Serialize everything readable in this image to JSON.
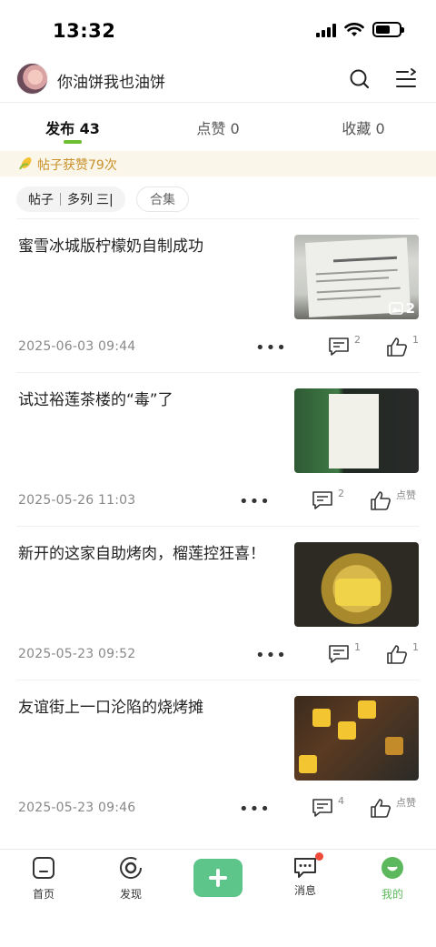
{
  "status": {
    "time": "13:32"
  },
  "header": {
    "username": "你油饼我也油饼"
  },
  "tabs": [
    {
      "label": "发布 43"
    },
    {
      "label": "点赞 0"
    },
    {
      "label": "收藏 0"
    }
  ],
  "banner": {
    "text": "帖子获赞79次"
  },
  "filters": {
    "posts": "帖子",
    "sort": "多列",
    "sort_icon": "三|",
    "collection": "合集"
  },
  "posts": [
    {
      "title": "蜜雪冰城版柠檬奶自制成功",
      "date": "2025-06-03 09:44",
      "comments": "2",
      "likes": "1",
      "image_count": "2"
    },
    {
      "title": "试过裕莲茶楼的“毒”了",
      "date": "2025-05-26 11:03",
      "comments": "2",
      "likes": "点赞"
    },
    {
      "title": "新开的这家自助烤肉，榴莲控狂喜！",
      "date": "2025-05-23 09:52",
      "comments": "1",
      "likes": "1"
    },
    {
      "title": "友谊街上一口沦陷的烧烤摊",
      "date": "2025-05-23 09:46",
      "comments": "4",
      "likes": "点赞"
    }
  ],
  "nav": [
    {
      "label": "首页",
      "icon": "home-icon"
    },
    {
      "label": "发现",
      "icon": "discover-icon"
    },
    {
      "label": "",
      "icon": "plus-icon"
    },
    {
      "label": "消息",
      "icon": "message-icon"
    },
    {
      "label": "我的",
      "icon": "profile-icon"
    }
  ],
  "colors": {
    "accent": "#6cbd2f",
    "add_button": "#5ec58a",
    "banner_text": "#c9912a",
    "badge": "#f04a3a"
  }
}
